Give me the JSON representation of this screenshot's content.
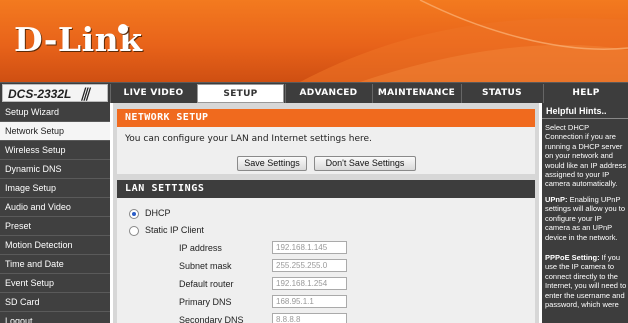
{
  "brand": {
    "logo_text": "D-Link"
  },
  "model": {
    "name": "DCS-2332L",
    "slashes": "///"
  },
  "tabs": [
    {
      "label": "LIVE VIDEO"
    },
    {
      "label": "SETUP"
    },
    {
      "label": "ADVANCED"
    },
    {
      "label": "MAINTENANCE"
    },
    {
      "label": "STATUS"
    },
    {
      "label": "HELP"
    }
  ],
  "active_tab": "SETUP",
  "sidebar": {
    "items": [
      {
        "label": "Setup Wizard"
      },
      {
        "label": "Network Setup"
      },
      {
        "label": "Wireless Setup"
      },
      {
        "label": "Dynamic DNS"
      },
      {
        "label": "Image Setup"
      },
      {
        "label": "Audio and Video"
      },
      {
        "label": "Preset"
      },
      {
        "label": "Motion Detection"
      },
      {
        "label": "Time and Date"
      },
      {
        "label": "Event Setup"
      },
      {
        "label": "SD Card"
      },
      {
        "label": "Logout"
      }
    ],
    "active": "Network Setup"
  },
  "network_setup": {
    "title": "NETWORK SETUP",
    "description": "You can configure your LAN and Internet settings here.",
    "save_label": "Save Settings",
    "dont_save_label": "Don't Save Settings"
  },
  "lan": {
    "title": "LAN SETTINGS",
    "dhcp_label": "DHCP",
    "static_label": "Static IP Client",
    "selected": "DHCP",
    "fields": [
      {
        "label": "IP address",
        "value": "192.168.1.145"
      },
      {
        "label": "Subnet mask",
        "value": "255.255.255.0"
      },
      {
        "label": "Default router",
        "value": "192.168.1.254"
      },
      {
        "label": "Primary DNS",
        "value": "168.95.1.1"
      },
      {
        "label": "Secondary DNS",
        "value": "8.8.8.8"
      }
    ]
  },
  "hints": {
    "title": "Helpful Hints..",
    "p1": "Select DHCP Connection if you are running a DHCP server on your network and would like an IP address assigned to your IP camera automatically.",
    "p2_title": "UPnP:",
    "p2": " Enabling UPnP settings will allow you to configure your IP camera as an UPnP device in the network.",
    "p3_title": "PPPoE Setting:",
    "p3": " If you use the IP camera to connect directly to the Internet, you will need to enter the username and password, which were"
  },
  "colors": {
    "accent_orange": "#f06a1e",
    "nav_dark": "#3d3d3d",
    "radio_blue": "#2a5cc7"
  }
}
